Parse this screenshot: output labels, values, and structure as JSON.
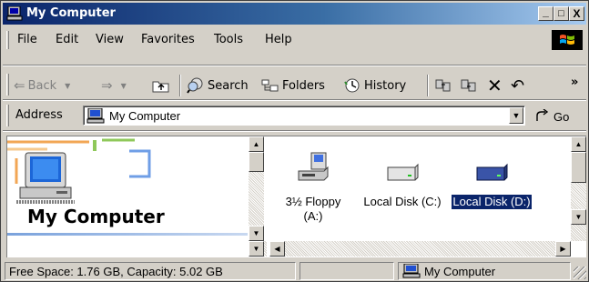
{
  "window": {
    "title": "My Computer",
    "title_icon": "my-computer-icon",
    "buttons": {
      "minimize": "_",
      "maximize": "□",
      "close": "X"
    }
  },
  "menu": {
    "items": [
      "File",
      "Edit",
      "View",
      "Favorites",
      "Tools",
      "Help"
    ]
  },
  "toolbar": {
    "back_label": "Back",
    "search_label": "Search",
    "folders_label": "Folders",
    "history_label": "History",
    "overflow": "»"
  },
  "address": {
    "label": "Address",
    "value": "My Computer",
    "go_label": "Go"
  },
  "left_pane": {
    "title": "My Computer"
  },
  "drives": [
    {
      "name": "3½ Floppy (A:)",
      "line1": "3½ Floppy",
      "line2": "(A:)",
      "icon": "floppy-drive-icon",
      "selected": false
    },
    {
      "name": "Local Disk (C:)",
      "line1": "Local Disk (C:)",
      "line2": "",
      "icon": "hard-disk-icon",
      "selected": false
    },
    {
      "name": "Local Disk (D:)",
      "line1": "Local Disk (D:)",
      "line2": "",
      "icon": "hard-disk-icon",
      "selected": true
    }
  ],
  "status": {
    "info": "Free Space: 1.76 GB, Capacity: 5.02 GB",
    "zone": "My Computer"
  },
  "colors": {
    "title_active": "#0a246a",
    "selection": "#0a246a",
    "face": "#d4d0c8"
  }
}
